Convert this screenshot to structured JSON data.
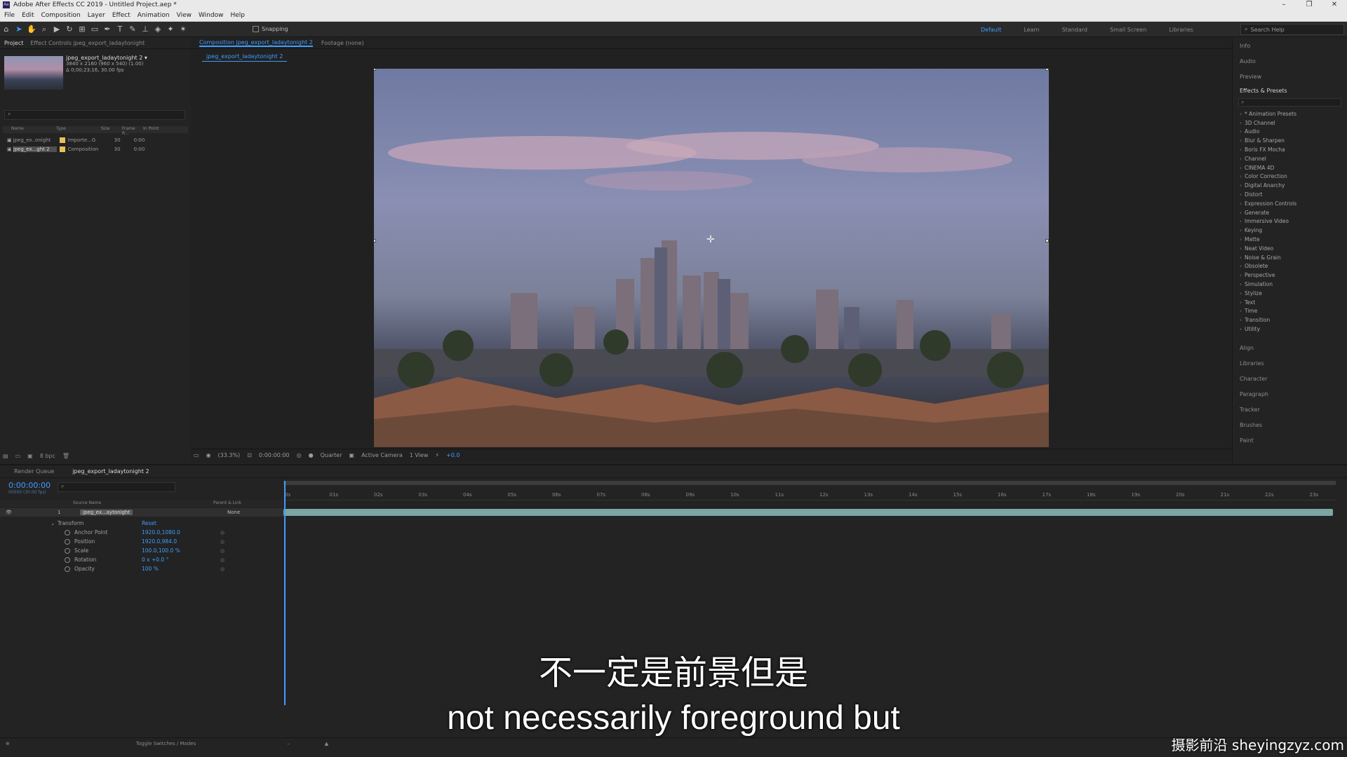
{
  "window": {
    "title": "Adobe After Effects CC 2019 - Untitled Project.aep *"
  },
  "menu": [
    "File",
    "Edit",
    "Composition",
    "Layer",
    "Effect",
    "Animation",
    "View",
    "Window",
    "Help"
  ],
  "toolbar": {
    "snapping_label": "Snapping"
  },
  "workspaces": [
    {
      "label": "Default",
      "active": true
    },
    {
      "label": "Learn",
      "active": false
    },
    {
      "label": "Standard",
      "active": false
    },
    {
      "label": "Small Screen",
      "active": false
    },
    {
      "label": "Libraries",
      "active": false
    }
  ],
  "search_help": {
    "placeholder": "Search Help"
  },
  "project_panel": {
    "tabs": [
      "Project",
      "Effect Controls jpeg_export_ladaytonight"
    ],
    "comp_name": "jpeg_export_ladaytonight 2 ▾",
    "comp_res": "3840 x 2160  (960 x 540) (1.00)",
    "comp_dur": "Δ 0;00;23;16, 30.00 fps",
    "columns": [
      "Name",
      "Type",
      "Size",
      "Frame R...",
      "In Point"
    ],
    "rows": [
      {
        "name": "jpeg_ex..onight",
        "type": "Importe...G",
        "fr": "30",
        "in": "0:00"
      },
      {
        "name": "jpeg_ex...ght 2",
        "type": "Composition",
        "fr": "30",
        "in": "0:00"
      }
    ],
    "bpc": "8 bpc"
  },
  "viewer": {
    "tab_comp": "Composition jpeg_export_ladaytonight 2",
    "tab_footage": "Footage (none)",
    "crumb": "jpeg_export_ladaytonight 2",
    "zoom": "(33.3%)",
    "time": "0:00:00:00",
    "resolution": "Quarter",
    "camera": "Active Camera",
    "views": "1 View",
    "exposure": "+0.0"
  },
  "right_panel": {
    "top_sections": [
      "Info",
      "Audio",
      "Preview"
    ],
    "effects_title": "Effects & Presets",
    "effects": [
      "* Animation Presets",
      "3D Channel",
      "Audio",
      "Blur & Sharpen",
      "Boris FX Mocha",
      "Channel",
      "CINEMA 4D",
      "Color Correction",
      "Digital Anarchy",
      "Distort",
      "Expression Controls",
      "Generate",
      "Immersive Video",
      "Keying",
      "Matte",
      "Neat Video",
      "Noise & Grain",
      "Obsolete",
      "Perspective",
      "Simulation",
      "Stylize",
      "Text",
      "Time",
      "Transition",
      "Utility"
    ],
    "bottom_sections": [
      "Align",
      "Libraries",
      "Character",
      "Paragraph",
      "Tracker",
      "Brushes",
      "Paint"
    ]
  },
  "timeline": {
    "tabs": [
      "Render Queue",
      "jpeg_export_ladaytonight 2"
    ],
    "timecode": "0:00:00:00",
    "timecode_sub": "00000 (30.00 fps)",
    "columns": {
      "source": "Source Name",
      "parent": "Parent & Link"
    },
    "layer": {
      "index": "1",
      "name": "jpeg_ex...aytonight",
      "parent": "None"
    },
    "transform": {
      "label": "Transform",
      "reset": "Reset"
    },
    "properties": [
      {
        "label": "Anchor Point",
        "value": "1920.0,1080.0"
      },
      {
        "label": "Position",
        "value": "1920.0,984.0"
      },
      {
        "label": "Scale",
        "value": "100.0,100.0 %"
      },
      {
        "label": "Rotation",
        "value": "0 x +0.0 °"
      },
      {
        "label": "Opacity",
        "value": "100 %"
      }
    ],
    "ticks": [
      "0s",
      "01s",
      "02s",
      "03s",
      "04s",
      "05s",
      "06s",
      "07s",
      "08s",
      "09s",
      "10s",
      "11s",
      "12s",
      "13s",
      "14s",
      "15s",
      "16s",
      "17s",
      "18s",
      "19s",
      "20s",
      "21s",
      "22s",
      "23s"
    ],
    "toggle": "Toggle Switches / Modes"
  },
  "subtitles": {
    "zh": "不一定是前景但是",
    "en": "not necessarily foreground but"
  },
  "watermark": "摄影前沿 sheyingzyz.com"
}
